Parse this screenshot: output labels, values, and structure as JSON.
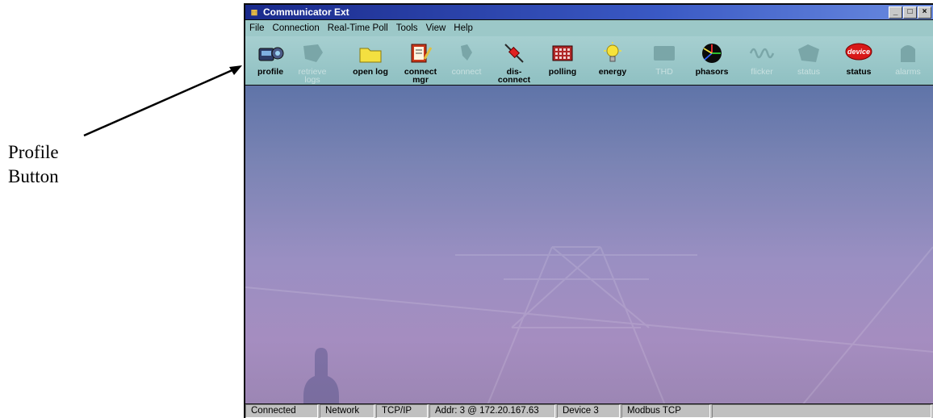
{
  "callout": {
    "line1": "Profile",
    "line2": "Button"
  },
  "window": {
    "title": "Communicator Ext"
  },
  "menu": [
    "File",
    "Connection",
    "Real-Time Poll",
    "Tools",
    "View",
    "Help"
  ],
  "toolbar": [
    {
      "label": "profile",
      "icon": "profile-icon",
      "enabled": true
    },
    {
      "label": "retrieve\nlogs",
      "icon": "retrieve-logs-icon",
      "enabled": false
    },
    {
      "label": "open log",
      "icon": "folder-icon",
      "enabled": true
    },
    {
      "label": "connect\nmgr",
      "icon": "connect-mgr-icon",
      "enabled": true
    },
    {
      "label": "connect",
      "icon": "connect-icon",
      "enabled": false
    },
    {
      "label": "dis-\nconnect",
      "icon": "disconnect-icon",
      "enabled": true
    },
    {
      "label": "polling",
      "icon": "polling-icon",
      "enabled": true
    },
    {
      "label": "energy",
      "icon": "lightbulb-icon",
      "enabled": true
    },
    {
      "label": "THD",
      "icon": "thd-icon",
      "enabled": false
    },
    {
      "label": "phasors",
      "icon": "phasors-icon",
      "enabled": true
    },
    {
      "label": "flicker",
      "icon": "flicker-icon",
      "enabled": false
    },
    {
      "label": "status",
      "icon": "status-icon",
      "enabled": false
    },
    {
      "label": "status",
      "icon": "device-status-icon",
      "badge": "device",
      "enabled": true
    },
    {
      "label": "alarms",
      "icon": "alarms-icon",
      "enabled": false
    }
  ],
  "status_bar": [
    "Connected",
    "Network",
    "TCP/IP",
    "Addr: 3 @ 172.20.167.63",
    "Device 3",
    "Modbus TCP"
  ]
}
